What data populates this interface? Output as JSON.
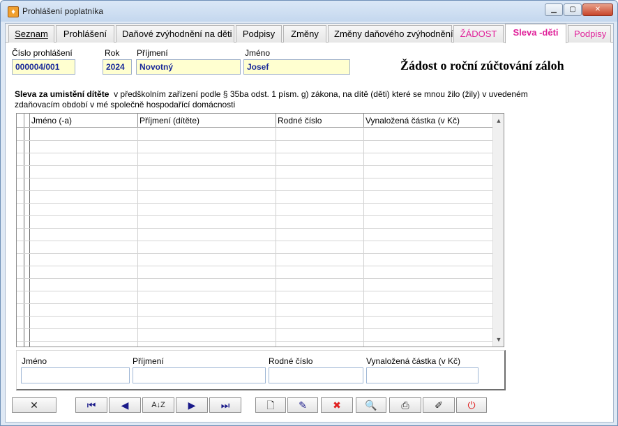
{
  "window": {
    "title": "Prohlášení poplatníka",
    "icon": "person-orange-icon",
    "controls": [
      "minimize-icon",
      "maximize-icon",
      "close-icon"
    ]
  },
  "tabs": [
    {
      "label": "Seznam",
      "style": "normal"
    },
    {
      "label": "Prohlášení",
      "style": "normal"
    },
    {
      "label": "Daňové zvýhodnění na děti",
      "style": "normal"
    },
    {
      "label": "Podpisy",
      "style": "normal"
    },
    {
      "label": "Změny",
      "style": "normal"
    },
    {
      "label": "Změny daňového zvýhodnění",
      "style": "normal"
    },
    {
      "label": "ŽÁDOST",
      "style": "pink"
    },
    {
      "label": "Sleva -děti",
      "style": "active"
    },
    {
      "label": "Podpisy",
      "style": "pink"
    }
  ],
  "form": {
    "cislo_label": "Číslo prohlášení",
    "cislo_value": "000004/001",
    "rok_label": "Rok",
    "rok_value": "2024",
    "prijmeni_label": "Příjmení",
    "prijmeni_value": "Novotný",
    "jmeno_label": "Jméno",
    "jmeno_value": "Josef",
    "heading": "Žádost o roční zúčtování záloh"
  },
  "description": {
    "bold": "Sleva za umistění dítěte",
    "rest": "v předškolním zařízení podle § 35ba odst. 1 písm. g) zákona, na dítě (děti) které se mnou žilo (žily) v uvedeném zdaňovacím období v mé společně hospodařící domácnosti"
  },
  "grid": {
    "columns": [
      "Jméno (-a)",
      "Příjmení  (dítěte)",
      "Rodné číslo",
      "Vynaložená částka (v Kč)"
    ],
    "rows": []
  },
  "detail": {
    "jmeno_label": "Jméno",
    "prijmeni_label": "Příjmení",
    "rodne_label": "Rodné číslo",
    "castka_label": "Vynaložená částka (v Kč)"
  },
  "colors": {
    "accent_pink": "#e0229a",
    "field_yellow": "#ffffd0",
    "field_text_blue": "#1a2a9a"
  },
  "toolbar": [
    "cancel-x-icon",
    "first-record-icon",
    "previous-record-icon",
    "sort-az-icon",
    "next-record-icon",
    "last-record-icon",
    "new-record-icon",
    "edit-record-icon",
    "delete-record-icon",
    "search-icon",
    "print-icon",
    "settings-icon",
    "power-exit-icon"
  ]
}
